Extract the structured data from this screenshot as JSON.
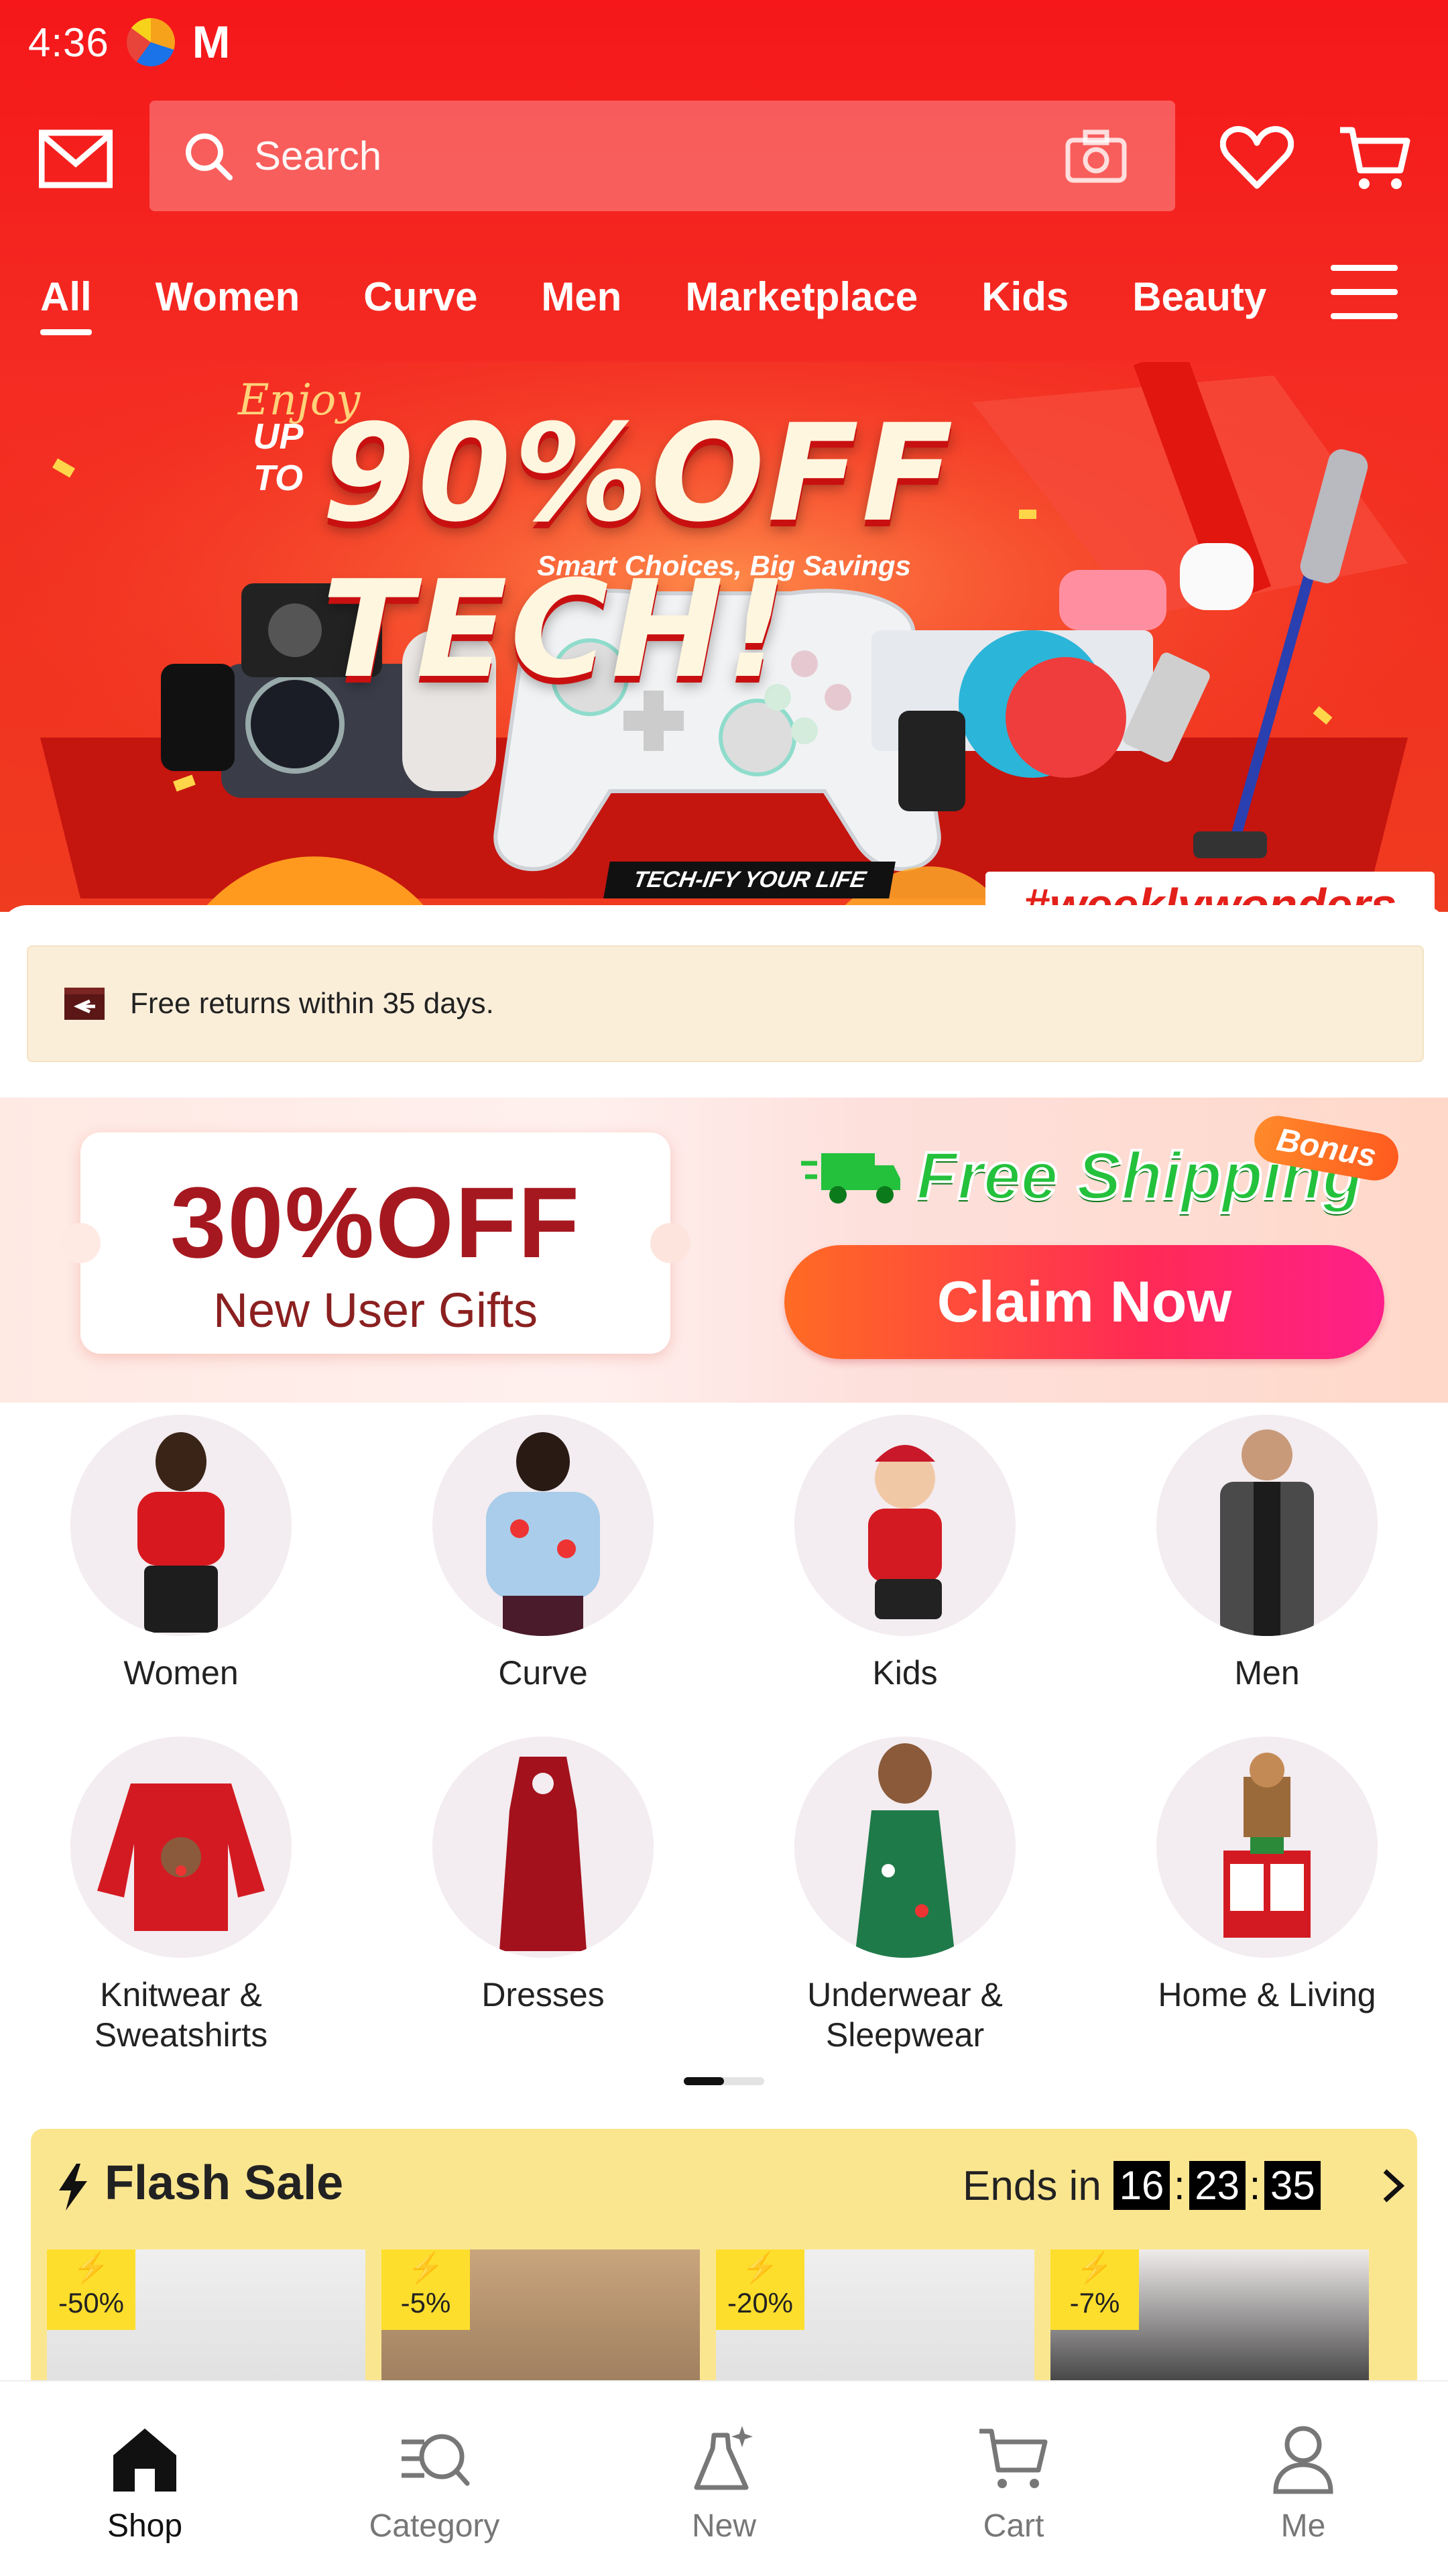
{
  "status": {
    "time": "4:36"
  },
  "search": {
    "placeholder": "Search"
  },
  "tabs": [
    "All",
    "Women",
    "Curve",
    "Men",
    "Marketplace",
    "Kids",
    "Beauty"
  ],
  "promo": {
    "enjoy": "Enjoy",
    "upto": "UP TO",
    "headline": "90%OFF TECH!",
    "subtitle": "Smart Choices, Big Savings",
    "tag": "TECH-IFY YOUR LIFE",
    "hashtag": "#weeklywonders"
  },
  "notice": {
    "text": "Free returns within 35 days."
  },
  "gift": {
    "discount": "30%OFF",
    "subtitle": "New User Gifts",
    "free_shipping": "Free Shipping",
    "bonus": "Bonus",
    "cta": "Claim Now"
  },
  "categories": [
    {
      "label": "Women"
    },
    {
      "label": "Curve"
    },
    {
      "label": "Kids"
    },
    {
      "label": "Men"
    },
    {
      "label": "Knitwear &\nSweatshirts"
    },
    {
      "label": "Dresses"
    },
    {
      "label": "Underwear &\nSleepwear"
    },
    {
      "label": "Home & Living"
    }
  ],
  "flash_sale": {
    "title": "Flash Sale",
    "ends_label": "Ends in",
    "timer": {
      "h": "16",
      "m": "23",
      "s": "35"
    },
    "items": [
      {
        "discount": "-50%"
      },
      {
        "discount": "-5%"
      },
      {
        "discount": "-20%"
      },
      {
        "discount": "-7%"
      }
    ]
  },
  "bottom_nav": [
    {
      "label": "Shop",
      "icon": "home-icon",
      "active": true
    },
    {
      "label": "Category",
      "icon": "category-search-icon"
    },
    {
      "label": "New",
      "icon": "new-dress-icon"
    },
    {
      "label": "Cart",
      "icon": "cart-icon"
    },
    {
      "label": "Me",
      "icon": "person-icon"
    }
  ],
  "colors": {
    "brand_red": "#f5171a",
    "claim_gradient": "#ff2a55",
    "flash_bg": "#fbe690"
  }
}
